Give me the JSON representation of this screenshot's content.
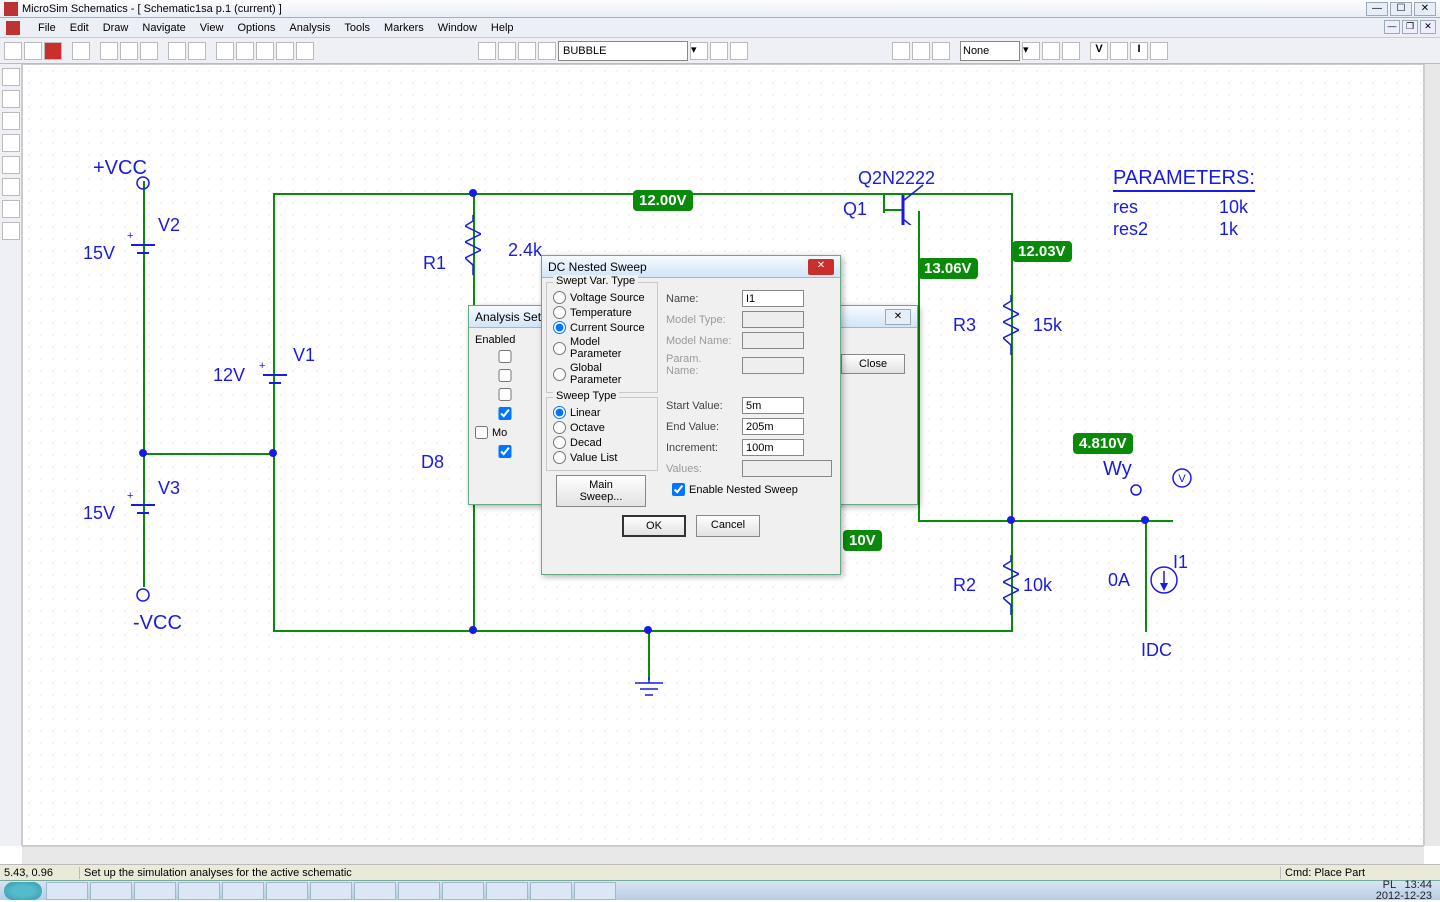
{
  "app": {
    "title": "MicroSim Schematics - [ Schematic1sa  p.1 (current)  ]",
    "menus": [
      "File",
      "Edit",
      "Draw",
      "Navigate",
      "View",
      "Options",
      "Analysis",
      "Tools",
      "Markers",
      "Window",
      "Help"
    ]
  },
  "toolbar": {
    "part_dropdown": "BUBBLE",
    "none_dropdown": "None"
  },
  "schematic": {
    "pvcc": "+VCC",
    "nvcc": "-VCC",
    "v1_name": "V1",
    "v1_val": "12V",
    "v2_name": "V2",
    "v2_val": "15V",
    "v3_name": "V3",
    "v3_val": "15V",
    "r1_name": "R1",
    "r1_val": "2.4k",
    "r2_name": "R2",
    "r2_val": "10k",
    "r3_name": "R3",
    "r3_val": "15k",
    "d8": "D8",
    "q1_name": "Q1",
    "q1_model": "Q2N2222",
    "wy": "Wy",
    "i1_name": "I1",
    "i1_val": "0A",
    "idc": "IDC",
    "b_top": "12.00V",
    "b_qcoll": "13.06V",
    "b_r3": "12.03V",
    "b_mid": "10V",
    "b_wy": "4.810V",
    "params_title": "PARAMETERS:",
    "p_r": "res",
    "p_rv": "10k",
    "p_r2": "res2",
    "p_r2v": "1k",
    "vprobe": "V"
  },
  "analysis_dlg": {
    "title": "Analysis Setup",
    "enabled": "Enabled",
    "close": "Close",
    "mo": "Mo"
  },
  "nested_dlg": {
    "title": "DC Nested Sweep",
    "swept_group": "Swept Var. Type",
    "svt": [
      "Voltage Source",
      "Temperature",
      "Current Source",
      "Model Parameter",
      "Global Parameter"
    ],
    "svt_selected": 2,
    "sweep_group": "Sweep Type",
    "st": [
      "Linear",
      "Octave",
      "Decad",
      "Value List"
    ],
    "st_selected": 0,
    "main_sweep": "Main Sweep...",
    "name_lbl": "Name:",
    "name_val": "I1",
    "model_type": "Model Type:",
    "model_name": "Model Name:",
    "param_name": "Param. Name:",
    "start_lbl": "Start Value:",
    "start_val": "5m",
    "end_lbl": "End Value:",
    "end_val": "205m",
    "inc_lbl": "Increment:",
    "inc_val": "100m",
    "values_lbl": "Values:",
    "enable_nested": "Enable Nested Sweep",
    "ok": "OK",
    "cancel": "Cancel"
  },
  "status": {
    "coords": "5.43,  0.96",
    "msg": "Set up the simulation analyses for the active schematic",
    "cmd": "Cmd: Place Part"
  },
  "clock": {
    "time": "13:44",
    "date": "2012-12-23",
    "lang": "PL"
  }
}
